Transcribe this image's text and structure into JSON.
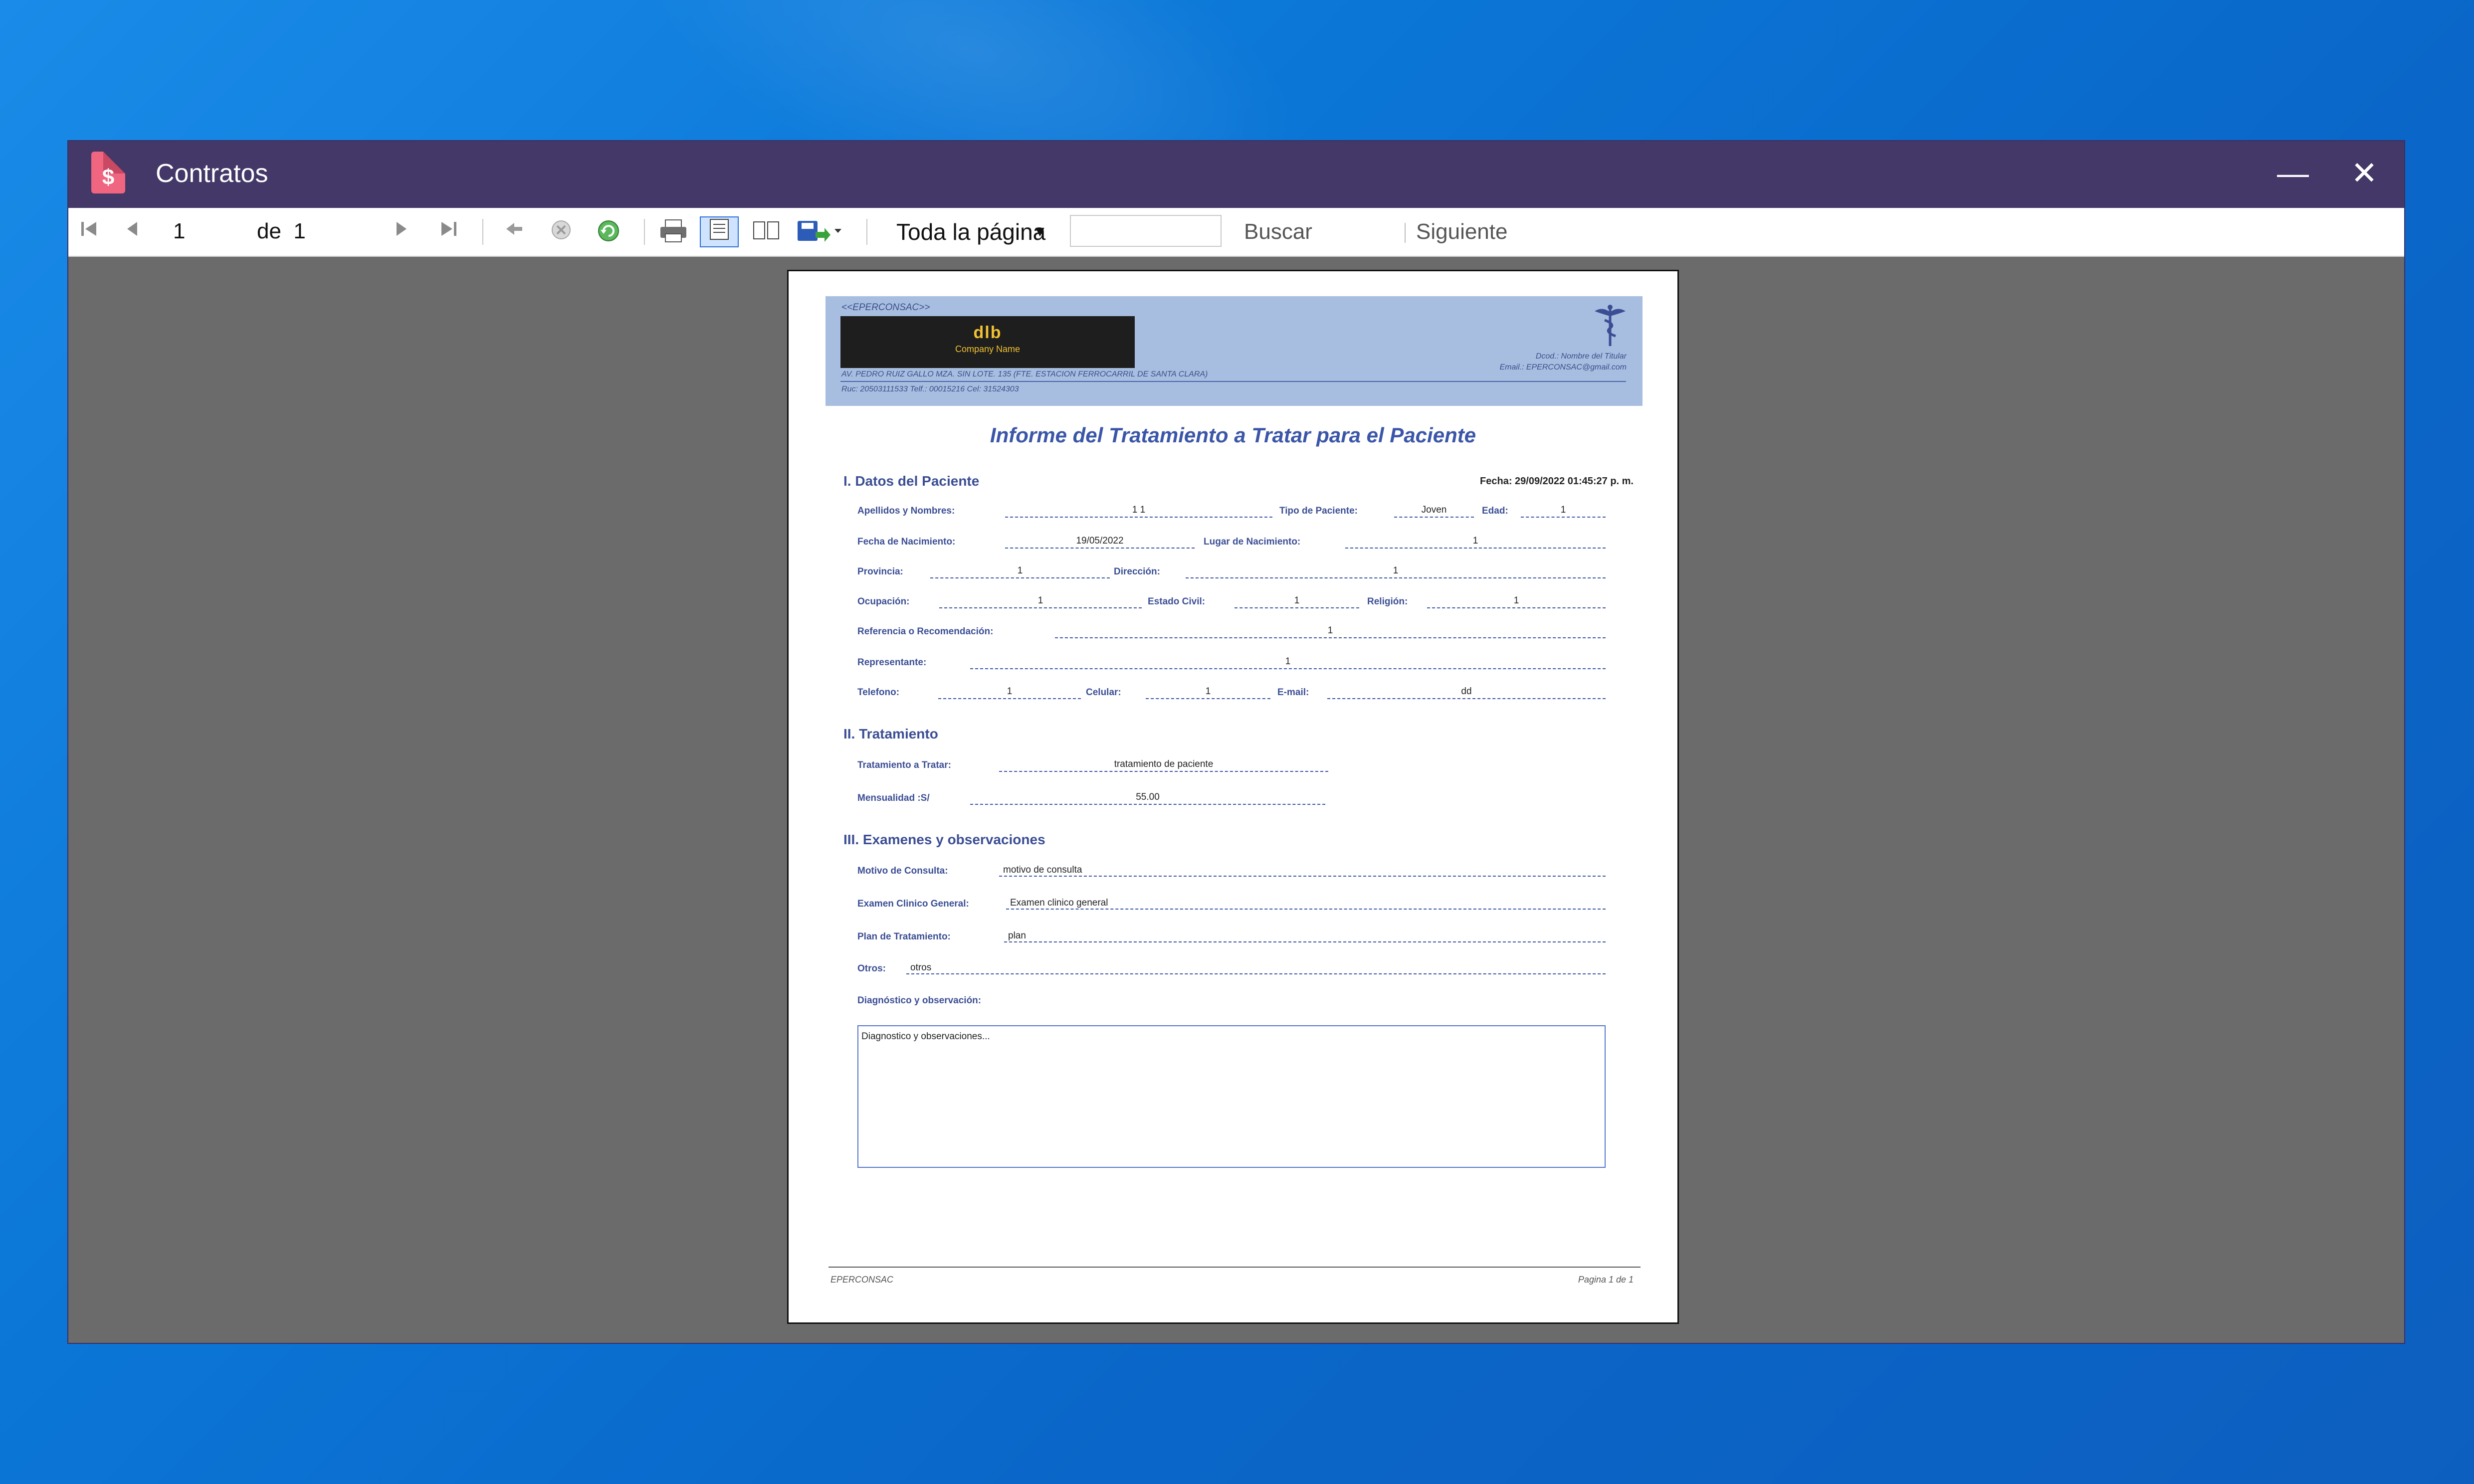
{
  "window": {
    "title": "Contratos",
    "minimize_glyph": "—",
    "close_glyph": "✕",
    "icon": "invoice-dollar-icon",
    "icon_glyph": "$"
  },
  "toolbar": {
    "page_current": "1",
    "page_of_label": "de",
    "page_total": "1",
    "zoom_value": "Toda la página",
    "search_value": "",
    "find_label": "Buscar",
    "next_label": "Siguiente",
    "icons": [
      "first-page-icon",
      "previous-page-icon",
      "next-page-icon",
      "last-page-icon",
      "back-icon",
      "stop-icon",
      "refresh-icon",
      "print-icon",
      "print-layout-icon",
      "page-setup-icon",
      "export-icon"
    ]
  },
  "report": {
    "company_tag": "<<EPERCONSAC>>",
    "logo_mark": "dlb",
    "logo_text": "Company Name",
    "address": "AV. PEDRO RUIZ GALLO MZA. SIN LOTE. 135 (FTE. ESTACION FERROCARRIL DE SANTA CLARA)",
    "ruc_tel": "Ruc: 20503111533  Telf.: 00015216  Cel: 31524303",
    "director": "Dcod.: Nombre del Titular",
    "email": "Email.: EPERCONSAC@gmail.com",
    "title": "Informe del Tratamiento a Tratar para el Paciente",
    "fecha": "Fecha: 29/09/2022 01:45:27 p. m.",
    "section1": "I. Datos del Paciente",
    "section2": "II. Tratamiento",
    "section3": "III. Examenes y observaciones",
    "fields": {
      "apellidos_label": "Apellidos y Nombres:",
      "apellidos_value": "1 1",
      "tipo_label": "Tipo de Paciente:",
      "tipo_value": "Joven",
      "edad_label": "Edad:",
      "edad_value": "1",
      "fecha_nac_label": "Fecha de Nacimiento:",
      "fecha_nac_value": "19/05/2022",
      "lugar_label": "Lugar de Nacimiento:",
      "lugar_value": "1",
      "provincia_label": "Provincia:",
      "provincia_value": "1",
      "direccion_label": "Dirección:",
      "direccion_value": "1",
      "ocupacion_label": "Ocupación:",
      "ocupacion_value": "1",
      "estado_label": "Estado Civil:",
      "estado_value": "1",
      "religion_label": "Religión:",
      "religion_value": "1",
      "referencia_label": "Referencia o Recomendación:",
      "referencia_value": "1",
      "representante_label": "Representante:",
      "representante_value": "1",
      "telefono_label": "Telefono:",
      "telefono_value": "1",
      "celular_label": "Celular:",
      "celular_value": "1",
      "email_label": "E-mail:",
      "email_value": "dd",
      "tratamiento_label": "Tratamiento a Tratar:",
      "tratamiento_value": "tratamiento de paciente",
      "mensualidad_label": "Mensualidad :S/",
      "mensualidad_value": "55.00",
      "motivo_label": "Motivo de Consulta:",
      "motivo_value": "motivo de consulta",
      "examen_label": "Examen Clinico General:",
      "examen_value": "Examen clinico general",
      "plan_label": "Plan de Tratamiento:",
      "plan_value": "plan",
      "otros_label": "Otros:",
      "otros_value": "otros",
      "diagnostico_label": "Diagnóstico y observación:",
      "diagnostico_value": "Diagnostico y observaciones..."
    },
    "footer_left": "EPERCONSAC",
    "footer_right": "Pagina 1 de 1"
  }
}
